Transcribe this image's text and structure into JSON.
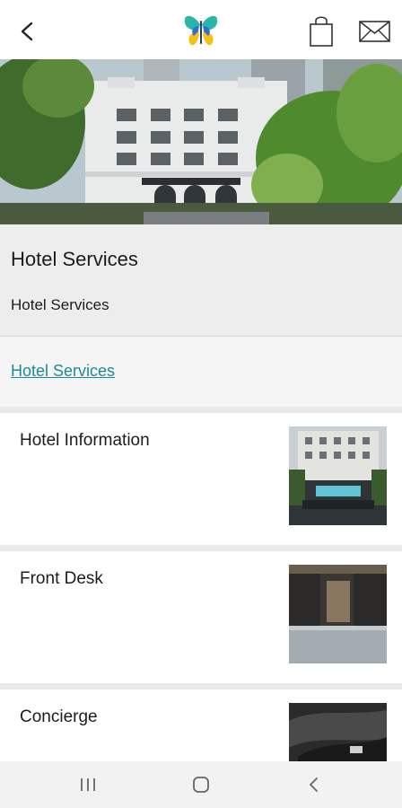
{
  "header": {
    "back_icon": "chevron-left-icon",
    "logo_icon": "butterfly-logo-icon",
    "bag_icon": "shopping-bag-icon",
    "mail_icon": "envelope-icon"
  },
  "hero": {
    "image": "hotel-exterior-photo"
  },
  "title_section": {
    "title": "Hotel Services",
    "subtitle": "Hotel Services"
  },
  "breadcrumb": {
    "link_label": "Hotel Services"
  },
  "cards": [
    {
      "label": "Hotel Information",
      "thumb": "hotel-courtyard-photo"
    },
    {
      "label": "Front Desk",
      "thumb": "front-desk-photo"
    },
    {
      "label": "Concierge",
      "thumb": "concierge-photo"
    }
  ],
  "system_nav": {
    "recents_icon": "recent-apps-icon",
    "home_icon": "home-icon",
    "back_icon": "back-arrow-icon"
  },
  "colors": {
    "link": "#1e8a92",
    "panel": "#ededed"
  }
}
